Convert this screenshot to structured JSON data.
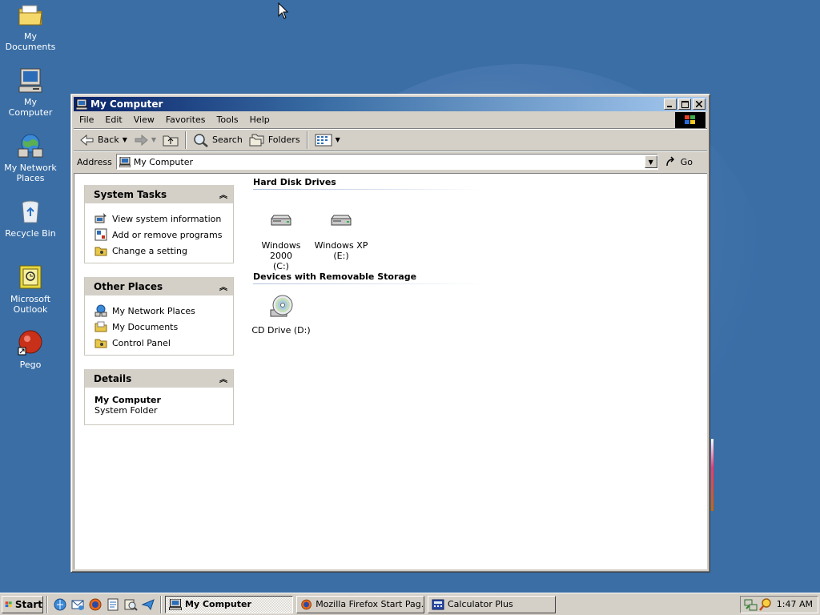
{
  "desktop": {
    "icons": [
      {
        "label": "My Documents",
        "icon": "folder-documents-icon"
      },
      {
        "label": "My Computer",
        "icon": "computer-icon"
      },
      {
        "label": "My Network Places",
        "icon": "network-places-icon"
      },
      {
        "label": "Recycle Bin",
        "icon": "recycle-bin-icon"
      },
      {
        "label": "Microsoft Outlook",
        "icon": "outlook-icon"
      },
      {
        "label": "Pego",
        "icon": "pego-icon"
      }
    ]
  },
  "window": {
    "title": "My Computer",
    "menu": [
      "File",
      "Edit",
      "View",
      "Favorites",
      "Tools",
      "Help"
    ],
    "toolbar": {
      "back": "Back",
      "search": "Search",
      "folders": "Folders"
    },
    "address": {
      "label": "Address",
      "value": "My Computer",
      "go": "Go"
    }
  },
  "sidebar": {
    "system_tasks": {
      "title": "System Tasks",
      "items": [
        "View system information",
        "Add or remove programs",
        "Change a setting"
      ]
    },
    "other_places": {
      "title": "Other Places",
      "items": [
        "My Network Places",
        "My Documents",
        "Control Panel"
      ]
    },
    "details": {
      "title": "Details",
      "name": "My Computer",
      "type": "System Folder"
    }
  },
  "main": {
    "hard_disks": {
      "heading": "Hard Disk Drives",
      "drives": [
        {
          "line1": "Windows 2000",
          "line2": "(C:)"
        },
        {
          "line1": "Windows XP",
          "line2": "(E:)"
        }
      ]
    },
    "removable": {
      "heading": "Devices with Removable Storage",
      "drives": [
        {
          "line1": "CD Drive (D:)"
        }
      ]
    }
  },
  "taskbar": {
    "start": "Start",
    "tasks": [
      {
        "label": "My Computer",
        "active": true
      },
      {
        "label": "Mozilla Firefox Start Pag...",
        "active": false
      },
      {
        "label": "Calculator Plus",
        "active": false
      }
    ],
    "clock": "1:47 AM"
  },
  "colors": {
    "desktop": "#3a6ea5",
    "titlebar_start": "#0a246a",
    "titlebar_end": "#a6caf0",
    "face": "#d4d0c8"
  }
}
